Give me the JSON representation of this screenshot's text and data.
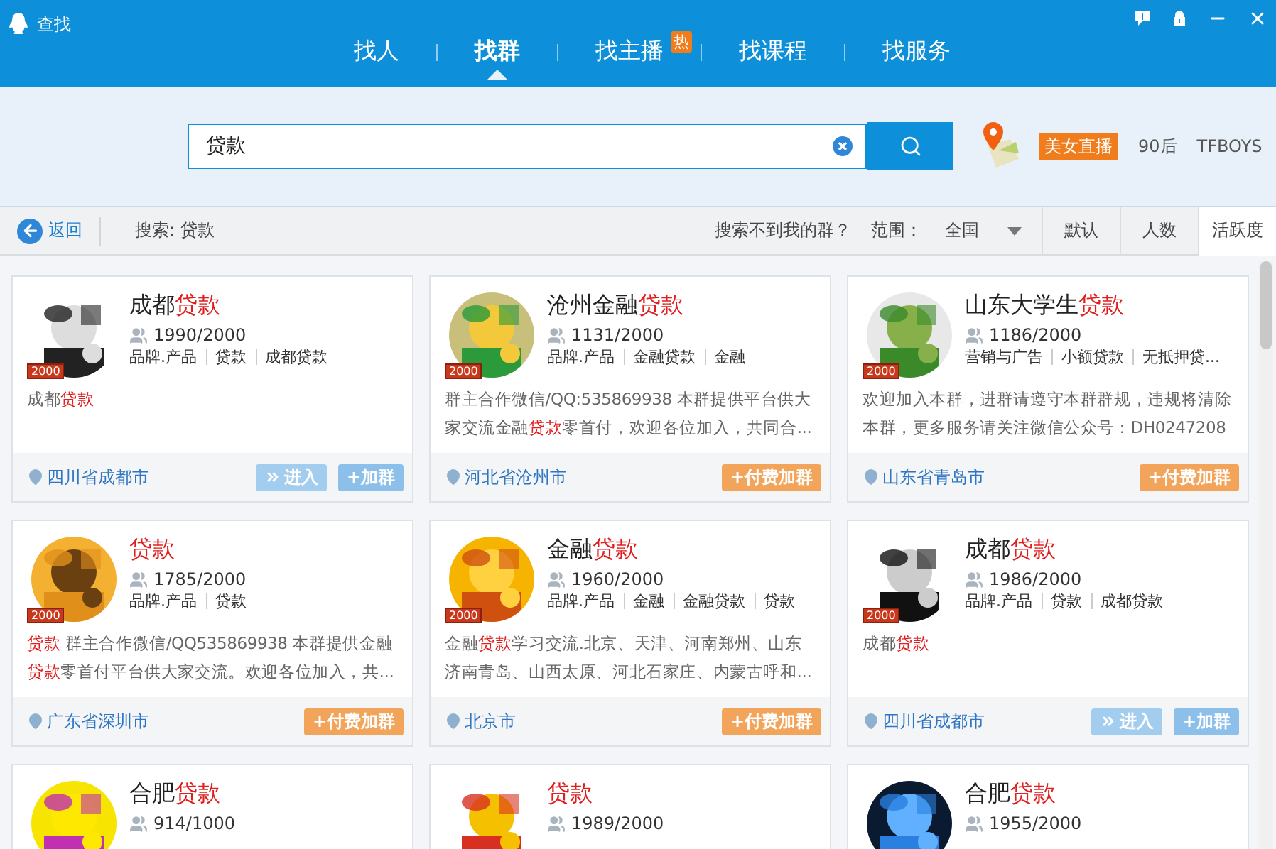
{
  "window": {
    "title": "查找"
  },
  "tabs": [
    {
      "label": "找人",
      "selected": false
    },
    {
      "label": "找群",
      "selected": true
    },
    {
      "label": "找主播",
      "selected": false,
      "badge": "热"
    },
    {
      "label": "找课程",
      "selected": false
    },
    {
      "label": "找服务",
      "selected": false
    }
  ],
  "search": {
    "value": "贷款"
  },
  "hot_tags": [
    {
      "label": "美女直播",
      "kind": "highlight"
    },
    {
      "label": "90后",
      "kind": "plain"
    },
    {
      "label": "TFBOYS",
      "kind": "plain"
    }
  ],
  "toolbar": {
    "back": "返回",
    "query": "搜索: 贷款",
    "help_link": "搜索不到我的群？",
    "range_label": "范围：",
    "range_value": "全国",
    "sort": [
      {
        "label": "默认",
        "selected": false
      },
      {
        "label": "人数",
        "selected": false
      },
      {
        "label": "活跃度",
        "selected": true
      }
    ]
  },
  "cards": [
    {
      "badge": "2000",
      "name": [
        {
          "text": "成都"
        },
        {
          "text": "贷款",
          "hl": true
        }
      ],
      "members": "1990/2000",
      "tags": [
        "品牌.产品",
        "贷款",
        "成都贷款"
      ],
      "description": [
        [
          {
            "text": "成都"
          },
          {
            "text": "贷款",
            "hl": true
          }
        ]
      ],
      "location": "四川省成都市",
      "buttons": [
        {
          "label": "进入",
          "kind": "enter"
        },
        {
          "label": "+加群",
          "kind": "join"
        }
      ]
    },
    {
      "badge": "2000",
      "name": [
        {
          "text": "沧州金融"
        },
        {
          "text": "贷款",
          "hl": true
        }
      ],
      "members": "1131/2000",
      "tags": [
        "品牌.产品",
        "金融贷款",
        "金融"
      ],
      "description": [
        [
          {
            "text": "群主合作微信/QQ:535869938 本群提供平台供大"
          }
        ],
        [
          {
            "text": "家交流金融"
          },
          {
            "text": "贷款",
            "hl": true
          },
          {
            "text": "零首付，欢迎各位加入，共同合..."
          }
        ]
      ],
      "location": "河北省沧州市",
      "buttons": [
        {
          "label": "+付费加群",
          "kind": "paid"
        }
      ]
    },
    {
      "badge": "2000",
      "name": [
        {
          "text": "山东大学生"
        },
        {
          "text": "贷款",
          "hl": true
        }
      ],
      "members": "1186/2000",
      "tags": [
        "营销与广告",
        "小额贷款",
        "无抵押贷..."
      ],
      "description": [
        [
          {
            "text": "欢迎加入本群，进群请遵守本群群规，违规将清除"
          }
        ],
        [
          {
            "text": "本群，更多服务请关注微信公众号：DH0247208"
          }
        ]
      ],
      "location": "山东省青岛市",
      "buttons": [
        {
          "label": "+付费加群",
          "kind": "paid"
        }
      ]
    },
    {
      "badge": "2000",
      "name": [
        {
          "text": "贷款",
          "hl": true
        }
      ],
      "members": "1785/2000",
      "tags": [
        "品牌.产品",
        "贷款"
      ],
      "description": [
        [
          {
            "text": "贷款",
            "hl": true
          },
          {
            "text": " 群主合作微信/QQ535869938 本群提供金融"
          }
        ],
        [
          {
            "text": "贷款",
            "hl": true
          },
          {
            "text": "零首付平台供大家交流。欢迎各位加入，共..."
          }
        ]
      ],
      "location": "广东省深圳市",
      "buttons": [
        {
          "label": "+付费加群",
          "kind": "paid"
        }
      ]
    },
    {
      "badge": "2000",
      "name": [
        {
          "text": "金融"
        },
        {
          "text": "贷款",
          "hl": true
        }
      ],
      "members": "1960/2000",
      "tags": [
        "品牌.产品",
        "金融",
        "金融贷款",
        "贷款"
      ],
      "description": [
        [
          {
            "text": "金融"
          },
          {
            "text": "贷款",
            "hl": true
          },
          {
            "text": "学习交流.北京、天津、河南郑州、山东"
          }
        ],
        [
          {
            "text": "济南青岛、山西太原、河北石家庄、内蒙古呼和..."
          }
        ]
      ],
      "location": "北京市",
      "buttons": [
        {
          "label": "+付费加群",
          "kind": "paid"
        }
      ]
    },
    {
      "badge": "2000",
      "name": [
        {
          "text": "成都"
        },
        {
          "text": "贷款",
          "hl": true
        }
      ],
      "members": "1986/2000",
      "tags": [
        "品牌.产品",
        "贷款",
        "成都贷款"
      ],
      "description": [
        [
          {
            "text": "成都"
          },
          {
            "text": "贷款",
            "hl": true
          }
        ]
      ],
      "location": "四川省成都市",
      "buttons": [
        {
          "label": "进入",
          "kind": "enter"
        },
        {
          "label": "+加群",
          "kind": "join"
        }
      ]
    },
    {
      "name": [
        {
          "text": "合肥"
        },
        {
          "text": "贷款",
          "hl": true
        }
      ],
      "members": "914/1000"
    },
    {
      "name": [
        {
          "text": "贷款",
          "hl": true
        }
      ],
      "members": "1989/2000"
    },
    {
      "name": [
        {
          "text": "合肥"
        },
        {
          "text": "贷款",
          "hl": true
        }
      ],
      "members": "1955/2000"
    }
  ]
}
